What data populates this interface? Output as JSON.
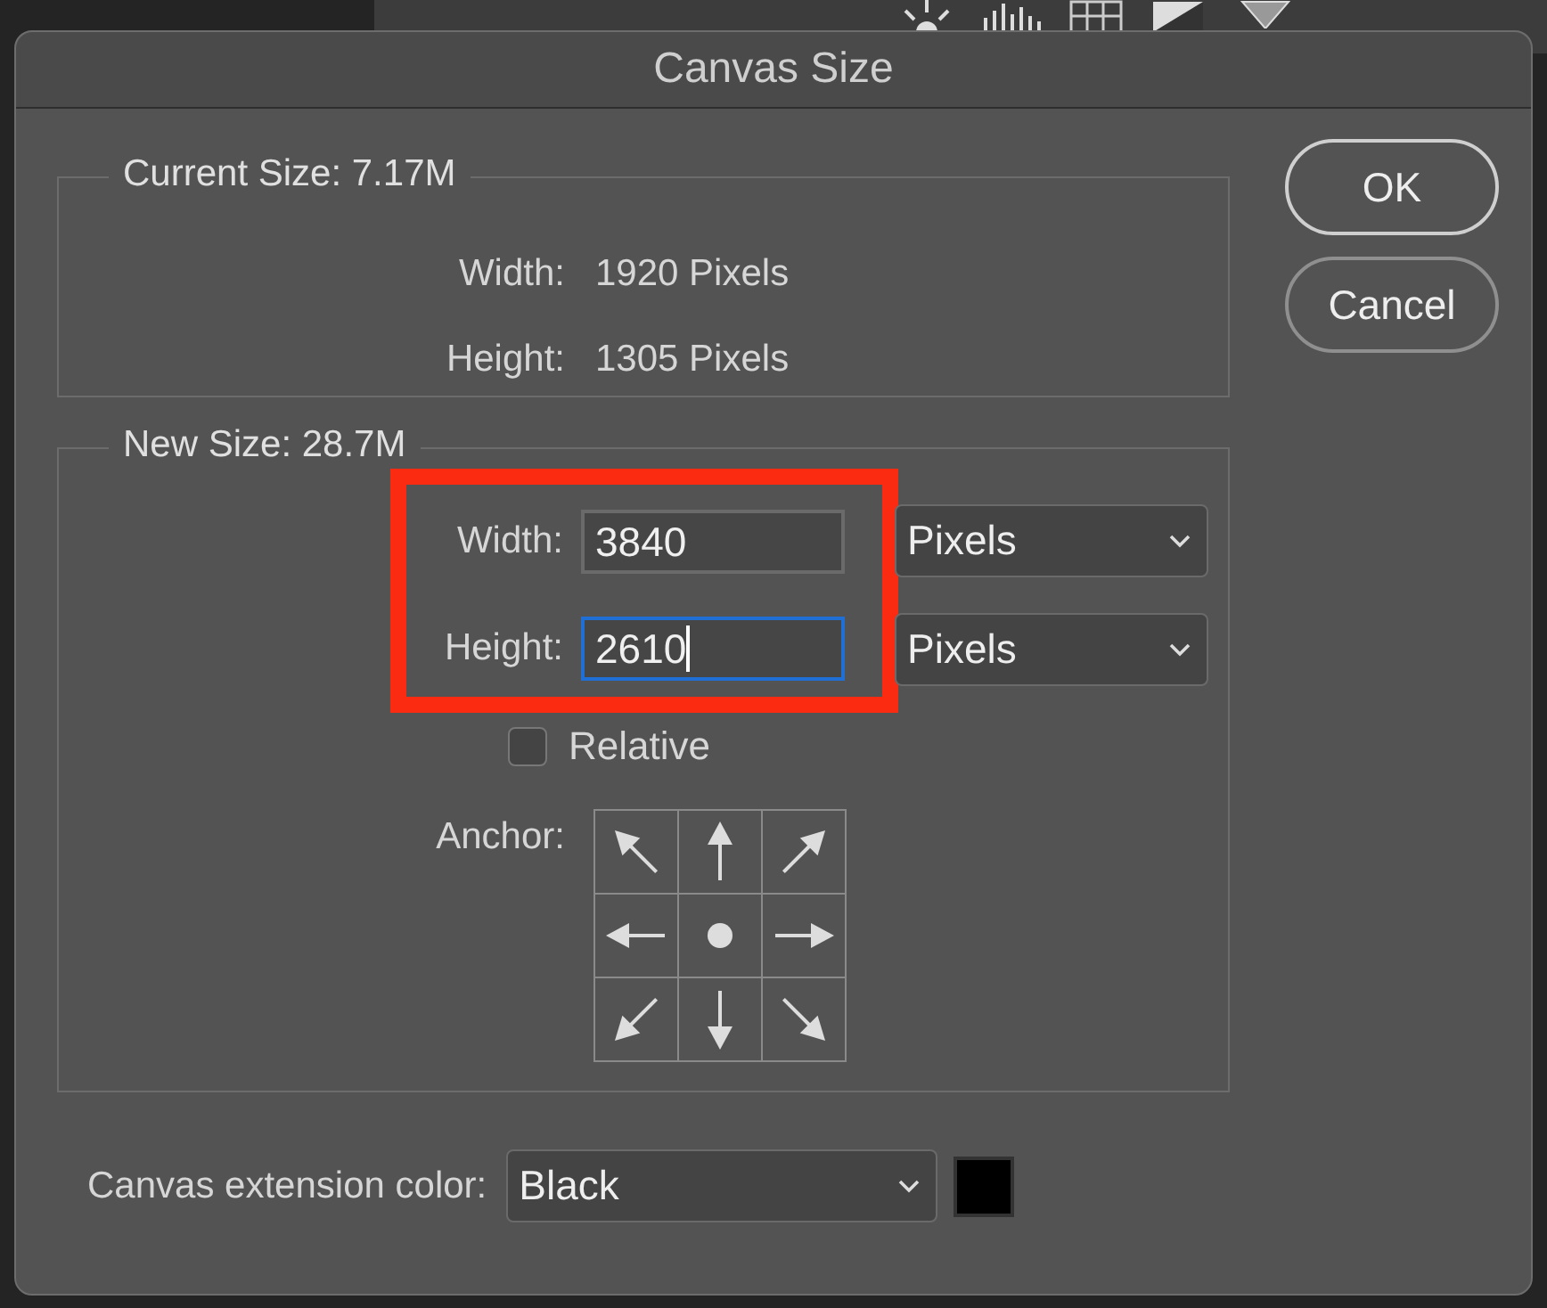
{
  "dialog": {
    "title": "Canvas Size"
  },
  "current_size": {
    "legend": "Current Size: 7.17M",
    "rows": [
      {
        "label": "Width:",
        "value": "1920 Pixels"
      },
      {
        "label": "Height:",
        "value": "1305 Pixels"
      }
    ]
  },
  "new_size": {
    "legend": "New Size: 28.7M",
    "highlighted": true,
    "rows": [
      {
        "label": "Width:",
        "value": "3840",
        "focused": false,
        "unit": "Pixels"
      },
      {
        "label": "Height:",
        "value": "2610",
        "focused": true,
        "unit": "Pixels"
      }
    ],
    "relative": {
      "label": "Relative",
      "checked": false
    },
    "anchor": {
      "label": "Anchor:",
      "cells": [
        {
          "selected": false
        },
        {
          "selected": false
        },
        {
          "selected": false
        },
        {
          "selected": false
        },
        {
          "selected": true
        },
        {
          "selected": false
        },
        {
          "selected": false
        },
        {
          "selected": false
        },
        {
          "selected": false
        }
      ]
    }
  },
  "extension": {
    "label": "Canvas extension color:",
    "value": "Black",
    "color": "#000000"
  },
  "buttons": [
    "OK",
    "Cancel"
  ]
}
